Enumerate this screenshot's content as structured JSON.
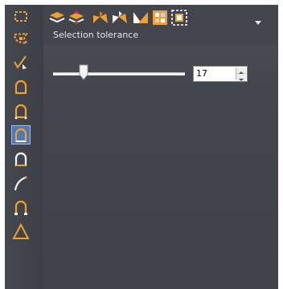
{
  "window": {
    "background": "#ffffff",
    "panel_color": "#43464d"
  },
  "left_toolbar": {
    "items": [
      {
        "icon": "dashed-rectangle-select-icon",
        "active": false
      },
      {
        "icon": "lasso-select-icon",
        "active": false
      },
      {
        "icon": "checkmark-pick-icon",
        "active": false
      },
      {
        "icon": "arch-outline-icon",
        "active": false
      },
      {
        "icon": "arch-dots-icon",
        "active": false
      },
      {
        "icon": "arch-selected-icon",
        "active": true
      },
      {
        "icon": "arch-white-icon",
        "active": false
      },
      {
        "icon": "curve-icon",
        "active": false
      },
      {
        "icon": "arch-vertices-icon",
        "active": false
      },
      {
        "icon": "triangle-icon",
        "active": false
      }
    ],
    "accent": "#f0a030",
    "active_color": "#4f79b4"
  },
  "top_toolbar": {
    "items": [
      {
        "icon": "layers-stack-icon"
      },
      {
        "icon": "layers-red-stack-icon"
      },
      {
        "icon": "orange-triangles-icon"
      },
      {
        "icon": "orange-white-triangles-icon"
      },
      {
        "icon": "orange-triangle-split-icon"
      },
      {
        "icon": "grid-checkered-icon"
      },
      {
        "icon": "grid-dashed-icon"
      }
    ],
    "more_icon": "chevron-down-icon"
  },
  "selection": {
    "label": "Selection tolerance",
    "value": "17",
    "slider_fraction": 0.23
  }
}
